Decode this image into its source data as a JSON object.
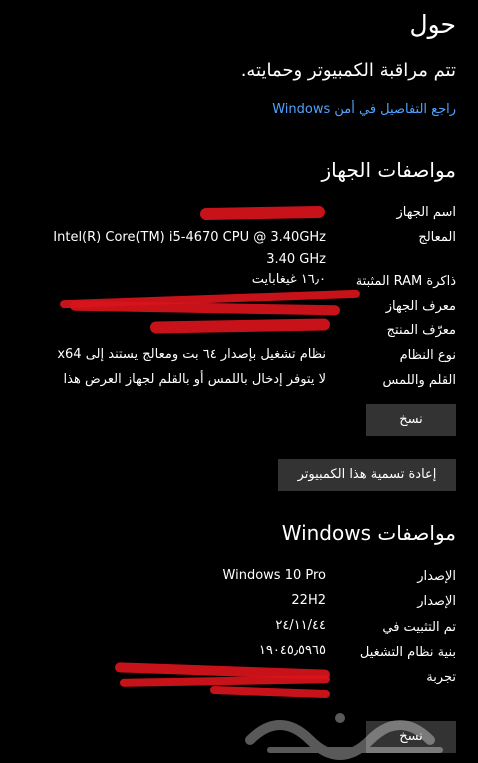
{
  "page": {
    "title": "حول",
    "status": "تتم مراقبة الكمبيوتر وحمايته.",
    "security_link": "راجع التفاصيل في أمن Windows"
  },
  "device_specs": {
    "heading": "مواصفات الجهاز",
    "rows": [
      {
        "label": "اسم الجهاز",
        "value": ""
      },
      {
        "label": "المعالج",
        "value": "Intel(R) Core(TM) i5-4670 CPU @ 3.40GHz   3.40 GHz"
      },
      {
        "label": "ذاكرة RAM المثبتة",
        "value": "١٦٫٠ غيغابايت"
      },
      {
        "label": "معرف الجهاز",
        "value": ""
      },
      {
        "label": "معرّف المنتج",
        "value": ""
      },
      {
        "label": "نوع النظام",
        "value": "نظام تشغيل بإصدار ٦٤ بت ومعالج يستند إلى x64"
      },
      {
        "label": "القلم واللمس",
        "value": "لا يتوفر إدخال باللمس أو بالقلم لجهاز العرض هذا"
      }
    ],
    "copy_button": "نسخ",
    "rename_button": "إعادة تسمية هذا الكمبيوتر"
  },
  "windows_specs": {
    "heading": "مواصفات Windows",
    "rows": [
      {
        "label": "الإصدار",
        "value": "Windows 10 Pro"
      },
      {
        "label": "الإصدار",
        "value": "22H2"
      },
      {
        "label": "تم التثبيت في",
        "value": "٢٤/١١/٤٤"
      },
      {
        "label": "بنية نظام التشغيل",
        "value": "١٩٠٤٥٫٥٩٦٥"
      },
      {
        "label": "تجربة",
        "value": ""
      }
    ],
    "copy_button": "نسخ"
  },
  "watermark_text": "حراج",
  "colors": {
    "background": "#000000",
    "link": "#4ea3ff",
    "button": "#333333",
    "redaction": "#d9141b"
  }
}
